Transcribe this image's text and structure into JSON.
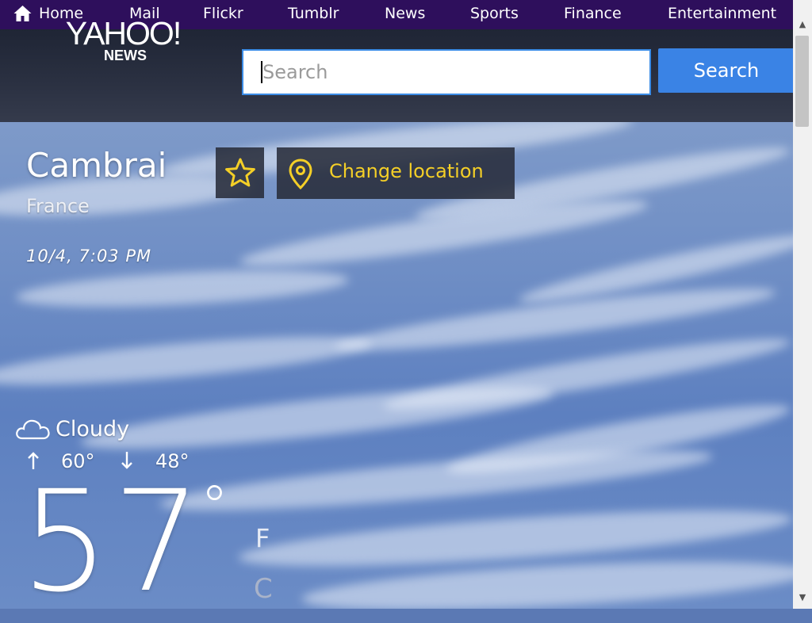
{
  "nav": {
    "items": [
      "Home",
      "Mail",
      "Flickr",
      "Tumblr",
      "News",
      "Sports",
      "Finance",
      "Entertainment"
    ]
  },
  "header": {
    "logo_main": "YAHOO!",
    "logo_sub": "NEWS",
    "search_placeholder": "Search",
    "search_button": "Search"
  },
  "location": {
    "city": "Cambrai",
    "country": "France",
    "datetime": "10/4, 7:03 PM",
    "change_label": "Change location"
  },
  "weather": {
    "condition": "Cloudy",
    "high": "60°",
    "low": "48°",
    "temperature": "57",
    "degree": "°",
    "unit_f": "F",
    "unit_c": "C"
  },
  "colors": {
    "nav_bg": "#2e0f5c",
    "accent_blue": "#3a83e5",
    "location_yellow": "#f4cf27"
  }
}
